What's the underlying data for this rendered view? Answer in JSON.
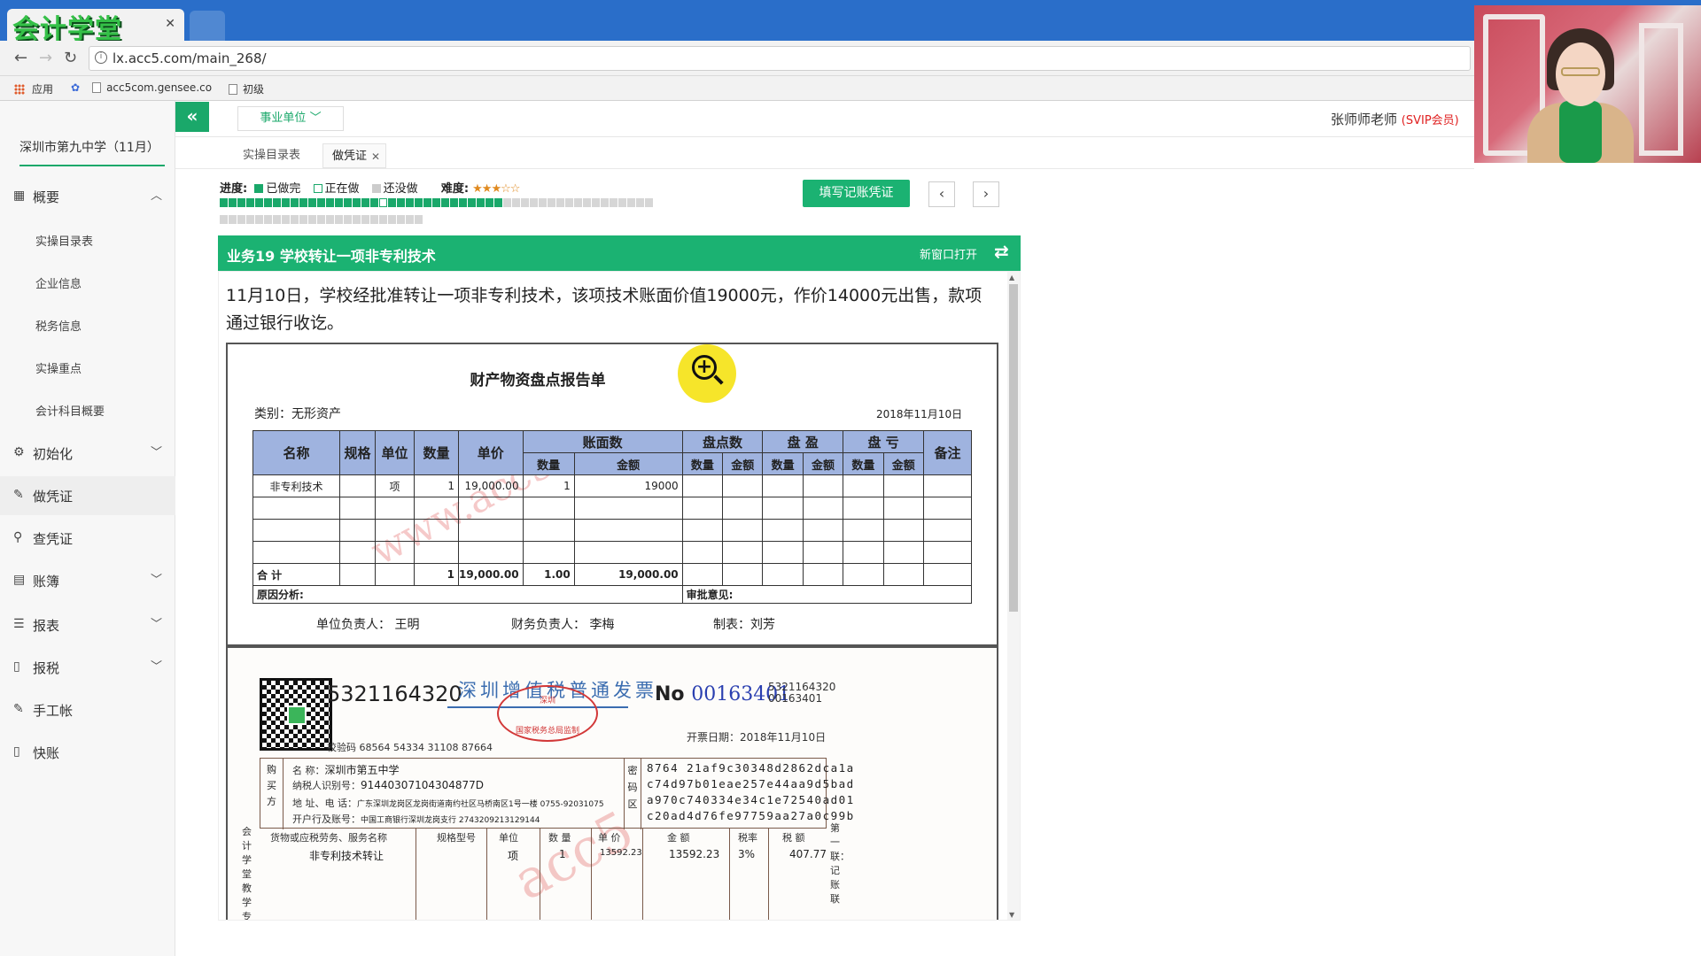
{
  "browser": {
    "logo_text": "会计学堂",
    "tab_label": "会计",
    "url": "lx.acc5.com/main_268/",
    "bookmarks": [
      "应用",
      "acc5com.gensee.co",
      "初级"
    ]
  },
  "header": {
    "unit_select": "事业单位",
    "teacher_name": "张师师老师",
    "teacher_badge": "(SVIP会员)"
  },
  "sidebar": {
    "school": "深圳市第九中学（11月）",
    "items": [
      {
        "label": "概要",
        "icon": "grid-icon",
        "expanded": true
      },
      {
        "label": "初始化",
        "icon": "gear-icon"
      },
      {
        "label": "做凭证",
        "icon": "pen-icon",
        "active": true
      },
      {
        "label": "查凭证",
        "icon": "search-icon"
      },
      {
        "label": "账簿",
        "icon": "book-icon"
      },
      {
        "label": "报表",
        "icon": "list-icon"
      },
      {
        "label": "报税",
        "icon": "file-icon"
      },
      {
        "label": "手工帐",
        "icon": "pen-icon"
      },
      {
        "label": "快账",
        "icon": "file-icon"
      }
    ],
    "sub_items": [
      "实操目录表",
      "企业信息",
      "税务信息",
      "实操重点",
      "会计科目概要"
    ]
  },
  "tabs": [
    {
      "label": "实操目录表"
    },
    {
      "label": "做凭证",
      "active": true
    }
  ],
  "progress": {
    "label": "进度:",
    "legend_done": "已做完",
    "legend_doing": "正在做",
    "legend_todo": "还没做",
    "difficulty_label": "难度:",
    "difficulty_stars": "★★★☆☆",
    "done_count": 32,
    "doing_index": 18,
    "total_count": 72
  },
  "fill_button": "填写记账凭证",
  "task": {
    "title": "业务19 学校转让一项非专利技术",
    "open_new": "新窗口打开",
    "description": "11月10日，学校经批准转让一项非专利技术，该项技术账面价值19000元，作价14000元出售，款项通过银行收讫。"
  },
  "inventory_report": {
    "title": "财产物资盘点报告单",
    "category": "类别：无形资产",
    "date": "2018年11月10日",
    "headers": [
      "名称",
      "规格",
      "单位",
      "数量",
      "单价",
      "账面数",
      "盘点数",
      "盘 盈",
      "盘 亏",
      "备注"
    ],
    "sub_headers": [
      "数量",
      "金额",
      "数量",
      "金额",
      "数量",
      "金额",
      "数量",
      "金额"
    ],
    "row": {
      "name": "非专利技术",
      "unit": "项",
      "qty": "1",
      "price": "19,000.00",
      "book_qty": "1",
      "book_amt": "19000"
    },
    "total": {
      "label": "合  计",
      "qty": "1",
      "price": "19,000.00",
      "book_qty": "1.00",
      "book_amt": "19,000.00"
    },
    "reason_label": "原因分析:",
    "approval_label": "审批意见:",
    "signers": [
      "单位负责人：  王明",
      "财务负责人：  李梅",
      "制表：刘芳"
    ],
    "watermark": "www.acc5.c"
  },
  "invoice": {
    "code": "5321164320",
    "title": "深圳增值税普通发票",
    "stamp": [
      "深圳",
      "国家税务总局监制"
    ],
    "no_label": "No",
    "no": "00163401",
    "code_small": "5321164320",
    "no_small": "00163401",
    "check_code": "校验码 68564 54334 31108 87664",
    "issue_date": "开票日期：2018年11月10日",
    "buyer_side": [
      "购",
      "买",
      "方"
    ],
    "buyer": {
      "name_label": "名        称：",
      "name": "深圳市第五中学",
      "tax_label": "纳税人识别号：",
      "tax_id": "91440307104304877D",
      "addr_label": "地  址、电  话：",
      "addr": "广东深圳龙岗区龙岗街道南约社区马桥南区1号一楼 0755-92031075",
      "bank_label": "开户行及账号：",
      "bank": "中国工商银行深圳龙岗支行 2743209213129144"
    },
    "mima_side": [
      "密",
      "码",
      "区"
    ],
    "cipher": [
      "8764 21af9c30348d2862dca1a",
      "c74d97b01eae257e44aa9d5bad",
      "a970c740334e34c1e72540ad01",
      "c20ad4d76fe97759aa27a0c99b"
    ],
    "item_headers": [
      "货物或应税劳务、服务名称",
      "规格型号",
      "单位",
      "数  量",
      "单  价",
      "金    额",
      "税率",
      "税    额"
    ],
    "item_row": [
      "非专利技术转让",
      "",
      "项",
      "1",
      "13592.23",
      "13592.23",
      "3%",
      "407.77"
    ],
    "left_vertical": "会计学堂教学专",
    "right_vertical": "第一联：记账联",
    "watermark": "acc5"
  },
  "colors": {
    "accent_green": "#1bb272",
    "browser_blue": "#2a6ec9",
    "table_header": "#9fb3df",
    "invoice_blue": "#3b6db0",
    "stamp_red": "#d23838"
  }
}
